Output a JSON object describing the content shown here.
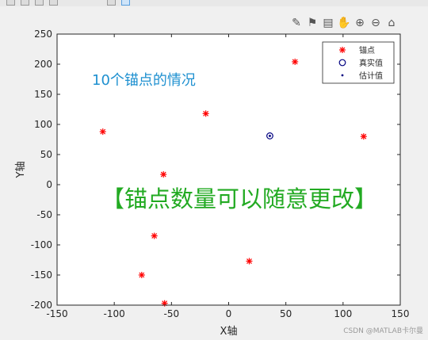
{
  "toolbar": {
    "icons": [
      "save-icon",
      "print-icon",
      "edit-icon",
      "cursor-icon",
      "datatip-icon",
      "pan-icon"
    ]
  },
  "axes_toolbar": {
    "icons": [
      "export-icon",
      "brush-icon",
      "datatip-icon",
      "rotate-icon",
      "zoom-in-icon",
      "zoom-out-icon",
      "home-icon"
    ]
  },
  "chart_data": {
    "type": "scatter",
    "title": "",
    "xlabel": "X轴",
    "ylabel": "Y轴",
    "xlim": [
      -150,
      150
    ],
    "ylim": [
      -200,
      250
    ],
    "xticks": [
      -150,
      -100,
      -50,
      0,
      50,
      100,
      150
    ],
    "yticks": [
      -200,
      -150,
      -100,
      -50,
      0,
      50,
      100,
      150,
      200,
      250
    ],
    "grid": false,
    "legend": {
      "position": "top-right",
      "entries": [
        "锚点",
        "真实值",
        "估计值"
      ]
    },
    "series": [
      {
        "name": "锚点",
        "marker": "*",
        "color": "#ff0000",
        "points": [
          [
            -110,
            88
          ],
          [
            -20,
            118
          ],
          [
            58,
            204
          ],
          [
            118,
            80
          ],
          [
            -57,
            17
          ],
          [
            -65,
            -85
          ],
          [
            18,
            -127
          ],
          [
            -76,
            -150
          ],
          [
            -56,
            -197
          ]
        ]
      },
      {
        "name": "真实值",
        "marker": "o",
        "color": "#000080",
        "points": [
          [
            36,
            81
          ]
        ]
      },
      {
        "name": "估计值",
        "marker": ".",
        "color": "#000080",
        "points": [
          [
            36,
            81
          ]
        ]
      }
    ],
    "annotations": [
      {
        "text": "10个锚点的情况",
        "color": "#1e90d0"
      },
      {
        "text": "【锚点数量可以随意更改】",
        "color": "#22aa22"
      }
    ]
  },
  "watermark": "CSDN @MATLAB卡尔曼",
  "colors": {
    "anchor": "#ff0000",
    "true": "#000080",
    "note1": "#1e90d0",
    "note2": "#22aa22"
  }
}
